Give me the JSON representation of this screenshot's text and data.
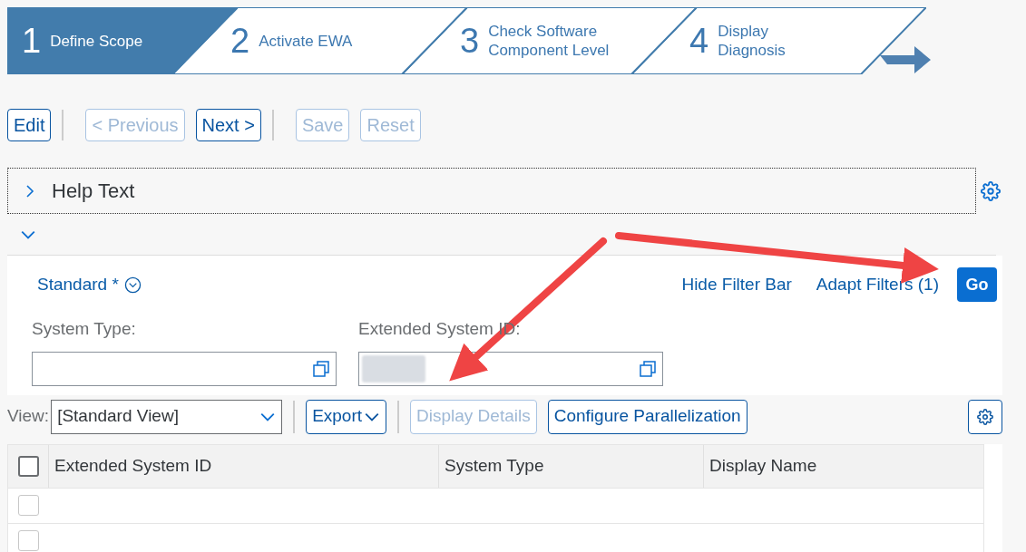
{
  "wizard": {
    "steps": [
      {
        "number": "1",
        "label": "Define Scope",
        "selected": true
      },
      {
        "number": "2",
        "label": "Activate EWA",
        "selected": false
      },
      {
        "number": "3",
        "label": "Check Software\nComponent Level",
        "selected": false
      },
      {
        "number": "4",
        "label": "Display\nDiagnosis",
        "selected": false
      }
    ]
  },
  "toolbar": [
    [
      {
        "label": "Edit",
        "disabled": false
      }
    ],
    [
      {
        "label": "< Previous",
        "disabled": true
      },
      {
        "label": "Next >",
        "disabled": false
      }
    ],
    [
      {
        "label": "Save",
        "disabled": true
      },
      {
        "label": "Reset",
        "disabled": true
      }
    ]
  ],
  "help_panel": {
    "title": "Help Text",
    "expanded": false
  },
  "filter_bar": {
    "expanded": true,
    "variant": "Standard *",
    "links": [
      "Hide Filter Bar",
      "Adapt Filters (1)"
    ],
    "go_button": "Go",
    "fields": [
      {
        "label": "System Type:",
        "obscured": false
      },
      {
        "label": "Extended System ID:",
        "obscured": true
      }
    ]
  },
  "table_toolbar": {
    "view_label": "View:",
    "view_value": "[Standard View]",
    "buttons": [
      {
        "label": "Export",
        "disabled": false,
        "dropdown": true
      },
      {
        "label": "Display Details",
        "disabled": true,
        "dropdown": false
      },
      {
        "label": "Configure Parallelization",
        "disabled": false,
        "dropdown": false
      }
    ]
  },
  "table": {
    "all_selected": false,
    "columns": [
      "Extended System ID",
      "System Type",
      "Display Name"
    ],
    "rows": [
      {
        "selected": false
      },
      {
        "selected": false
      }
    ]
  }
}
